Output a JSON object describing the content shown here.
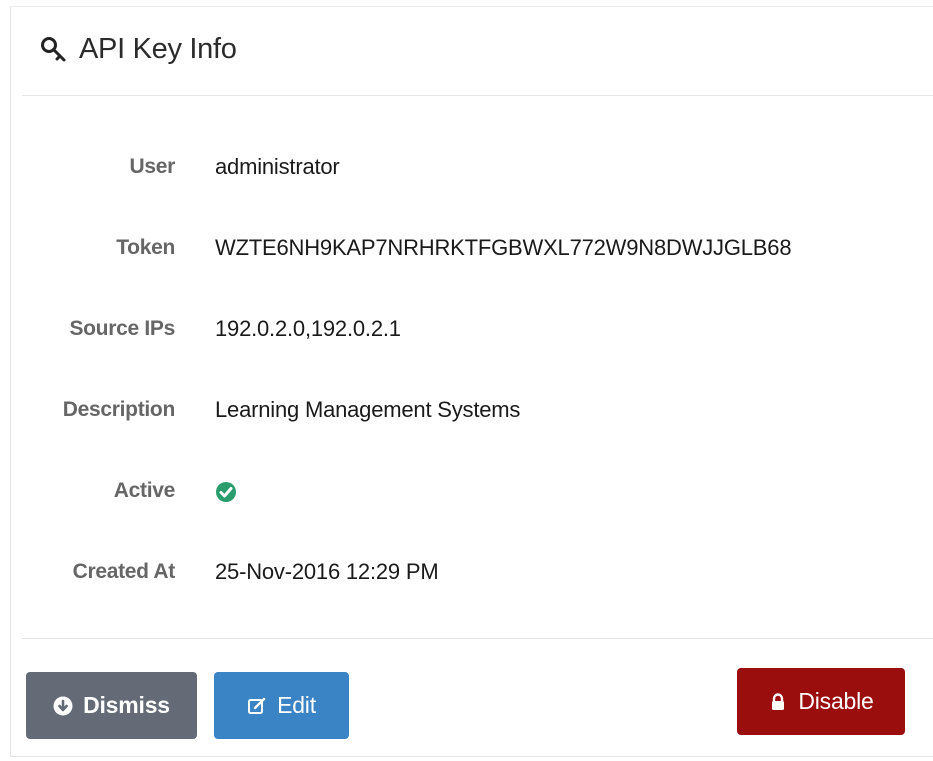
{
  "header": {
    "title": "API Key Info",
    "icon": "key-icon"
  },
  "fields": {
    "user": {
      "label": "User",
      "value": "administrator"
    },
    "token": {
      "label": "Token",
      "value": "WZTE6NH9KAP7NRHRKTFGBWXL772W9N8DWJJGLB68"
    },
    "source_ips": {
      "label": "Source IPs",
      "value": "192.0.2.0,192.0.2.1"
    },
    "description": {
      "label": "Description",
      "value": "Learning Management Systems"
    },
    "active": {
      "label": "Active",
      "icon": "check-circle-icon",
      "icon_color": "#2a9d6e"
    },
    "created_at": {
      "label": "Created At",
      "value": "25-Nov-2016 12:29 PM"
    }
  },
  "actions": {
    "dismiss_label": "Dismiss",
    "edit_label": "Edit",
    "disable_label": "Disable"
  },
  "colors": {
    "dismiss": "#646b76",
    "edit": "#3a83c4",
    "disable": "#9b0e0e"
  }
}
